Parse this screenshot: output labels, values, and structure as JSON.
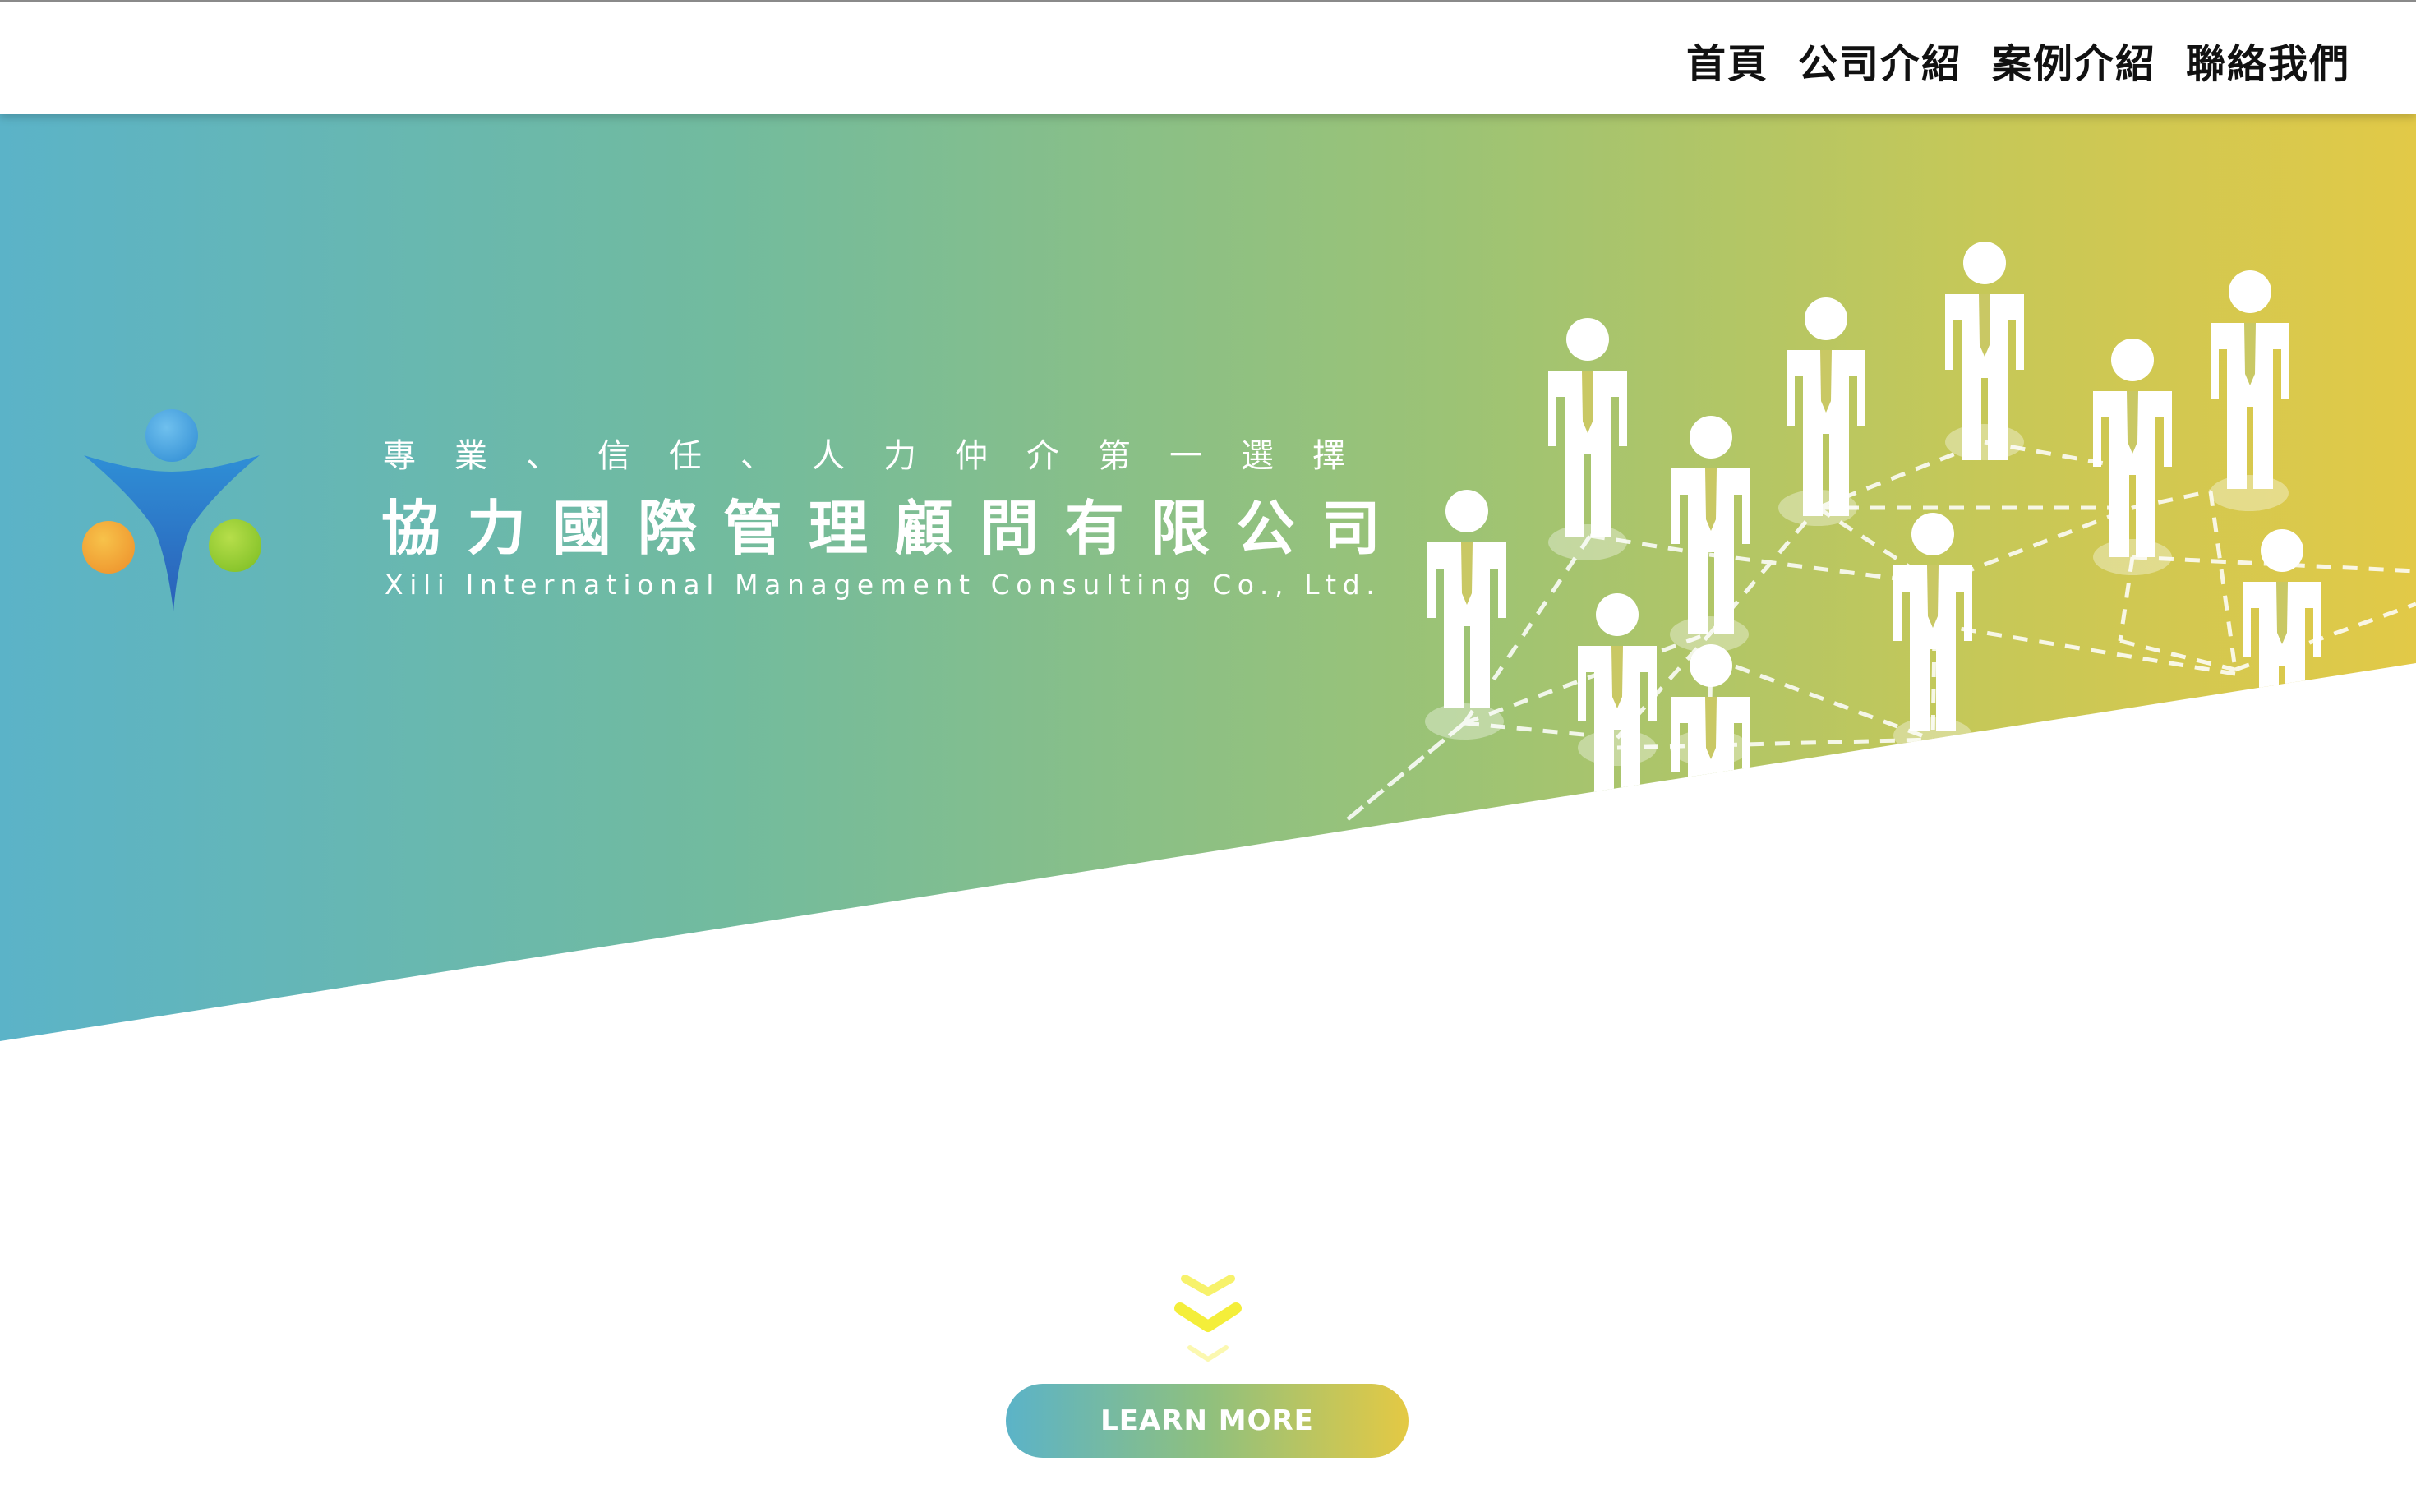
{
  "nav": {
    "items": [
      {
        "label": "首頁"
      },
      {
        "label": "公司介紹"
      },
      {
        "label": "案例介紹"
      },
      {
        "label": "聯絡我們"
      }
    ]
  },
  "hero": {
    "slogan": "專業、信任、人力仲介第一選擇",
    "company_name_cn": "協力國際管理顧問有限公司",
    "company_name_en": "Xili International Management Consulting Co., Ltd."
  },
  "cta": {
    "learn_more_label": "LEARN MORE"
  },
  "colors": {
    "gradient_start": "#5bb3c8",
    "gradient_mid": "#9cc375",
    "gradient_end": "#e2c947",
    "chevron": "#f4ee3a",
    "logo_blue": "#2f6fc4",
    "logo_orange": "#f2a83a",
    "logo_green": "#9ccf3a"
  },
  "icons": {
    "logo": "company-logo-figure",
    "scroll": "chevron-down-icon",
    "people": "businessman-icon"
  }
}
